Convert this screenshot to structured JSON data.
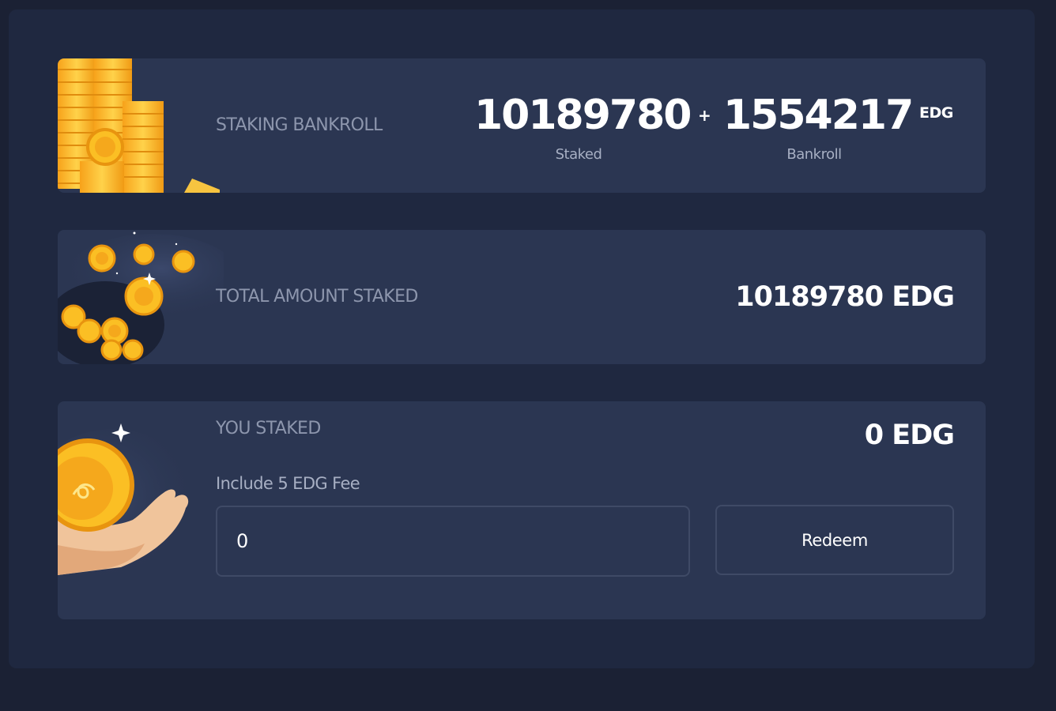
{
  "bankroll_card": {
    "label": "STAKING BANKROLL",
    "staked_value": "10189780",
    "plus_sign": "+",
    "bankroll_value": "1554217",
    "unit": "EDG",
    "staked_caption": "Staked",
    "bankroll_caption": "Bankroll",
    "icon": "coin-stacks-icon"
  },
  "total_card": {
    "label": "TOTAL AMOUNT STAKED",
    "value": "10189780 EDG",
    "icon": "coin-pot-icon"
  },
  "you_card": {
    "label": "YOU STAKED",
    "value": "0 EDG",
    "fee_label": "Include 5 EDG Fee",
    "input_value": "0",
    "redeem_label": "Redeem",
    "icon": "coin-hand-icon"
  },
  "colors": {
    "background": "#1b2134",
    "panel": "#1f2840",
    "card": "#2b3652",
    "coin": "#f5b51f"
  }
}
